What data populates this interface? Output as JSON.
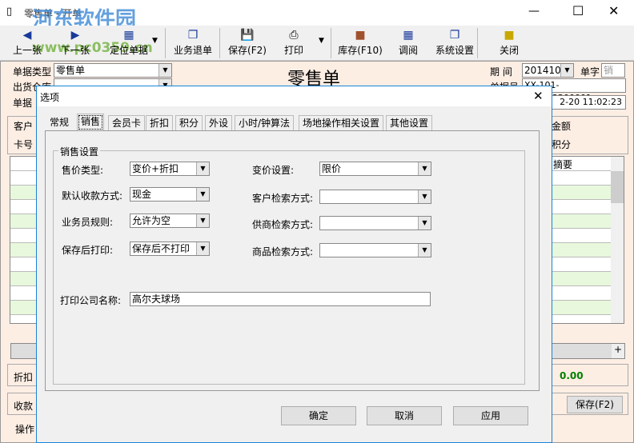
{
  "window": {
    "title": "零售单 - 开单",
    "watermark": "河东软件园",
    "watermark_url": "www.pc0359.cn"
  },
  "toolbar": [
    {
      "label": "上一张",
      "icon": "arrow-left-icon"
    },
    {
      "label": "下一张",
      "icon": "arrow-right-icon"
    },
    {
      "label": "定位单据",
      "icon": "locate-icon"
    },
    {
      "label": "业务退单",
      "icon": "return-icon"
    },
    {
      "label": "保存(F2)",
      "icon": "save-icon"
    },
    {
      "label": "打印",
      "icon": "print-icon"
    },
    {
      "label": "库存(F10)",
      "icon": "inventory-icon"
    },
    {
      "label": "调阅",
      "icon": "view-icon"
    },
    {
      "label": "系统设置",
      "icon": "settings-icon"
    },
    {
      "label": "关闭",
      "icon": "close-icon"
    }
  ],
  "form": {
    "doc_type_label": "单据类型",
    "doc_type": "零售单",
    "warehouse_label": "出货仓库",
    "doc_label": "单据",
    "heading": "零售单",
    "period_label": "期  间",
    "period": "201410",
    "word_label": "单字",
    "word": "销",
    "docno_label": "单据号",
    "docno": "XX-101-201912200001",
    "datetime": "2-20 11:02:23",
    "customer_label": "客户",
    "card_label": "卡号",
    "amount_label": "金额",
    "points_label": "积分",
    "summary_col": "摘要",
    "discount_label": "折扣",
    "total_value": "0.00",
    "receive_label": "收款",
    "save_btn": "保存(F2)",
    "operator_label": "操作"
  },
  "dialog": {
    "title": "选项",
    "tabs": [
      "常规",
      "销售",
      "会员卡",
      "折扣",
      "积分",
      "外设",
      "小时/钟算法",
      "场地操作相关设置",
      "其他设置"
    ],
    "group_title": "销售设置",
    "fields": {
      "price_type_label": "售价类型:",
      "price_type": "变价+折扣",
      "pay_method_label": "默认收款方式:",
      "pay_method": "现金",
      "salesman_label": "业务员规则:",
      "salesman": "允许为空",
      "after_save_label": "保存后打印:",
      "after_save": "保存后不打印",
      "price_change_label": "变价设置:",
      "price_change": "限价",
      "cust_search_label": "客户检索方式:",
      "cust_search": "",
      "supplier_search_label": "供商检索方式:",
      "supplier_search": "",
      "product_search_label": "商品检索方式:",
      "product_search": "",
      "company_label": "打印公司名称:",
      "company": "高尔夫球场"
    },
    "buttons": {
      "ok": "确定",
      "cancel": "取消",
      "apply": "应用"
    }
  }
}
